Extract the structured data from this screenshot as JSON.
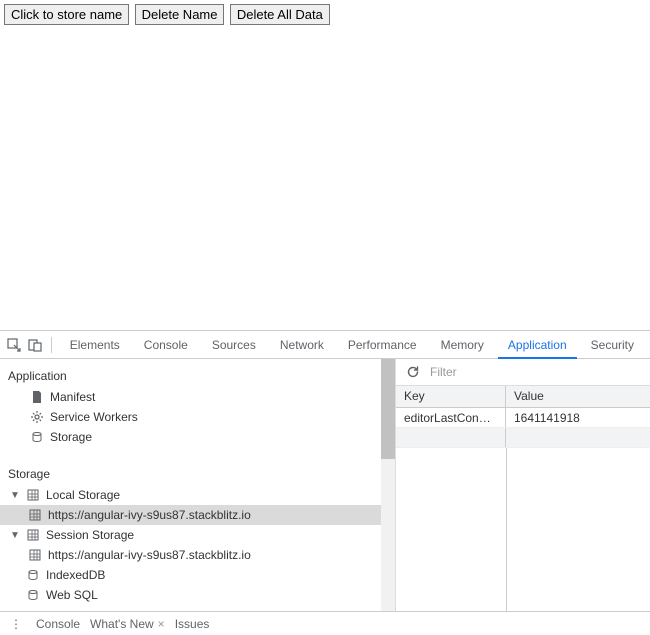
{
  "page": {
    "buttons": {
      "store": "Click to store name",
      "delete_name": "Delete Name",
      "delete_all": "Delete All Data"
    }
  },
  "devtools": {
    "tabs": {
      "elements": "Elements",
      "console": "Console",
      "sources": "Sources",
      "network": "Network",
      "performance": "Performance",
      "memory": "Memory",
      "application": "Application",
      "security": "Security"
    },
    "sidebar": {
      "application_section": "Application",
      "manifest": "Manifest",
      "service_workers": "Service Workers",
      "storage_item": "Storage",
      "storage_section": "Storage",
      "local_storage": "Local Storage",
      "local_storage_origin": "https://angular-ivy-s9us87.stackblitz.io",
      "session_storage": "Session Storage",
      "session_storage_origin": "https://angular-ivy-s9us87.stackblitz.io",
      "indexeddb": "IndexedDB",
      "websql": "Web SQL"
    },
    "detail": {
      "filter_placeholder": "Filter",
      "headers": {
        "key": "Key",
        "value": "Value"
      },
      "rows": [
        {
          "key": "editorLastConnec...",
          "value": "1641141918"
        }
      ]
    },
    "drawer": {
      "console": "Console",
      "whats_new": "What's New",
      "issues": "Issues"
    }
  }
}
